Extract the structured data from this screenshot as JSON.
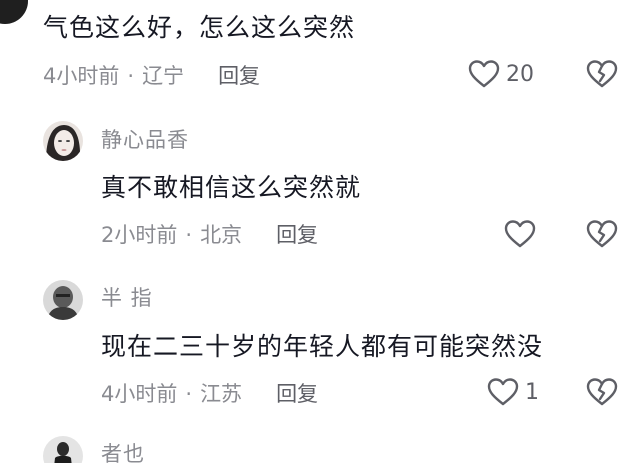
{
  "comments": [
    {
      "text": "气色这么好，怎么这么突然",
      "time": "4小时前",
      "location": "辽宁",
      "reply": "回复",
      "likes": "20"
    },
    {
      "user": "静心品香",
      "text": "真不敢相信这么突然就",
      "time": "2小时前",
      "location": "北京",
      "reply": "回复"
    },
    {
      "user": "半 指",
      "text": "现在二三十岁的年轻人都有可能突然没",
      "time": "4小时前",
      "location": "江苏",
      "reply": "回复",
      "likes": "1"
    },
    {
      "user": "者也"
    }
  ],
  "separator": "·",
  "icons": {
    "like": "heart-outline-icon",
    "dislike": "broken-heart-icon"
  }
}
